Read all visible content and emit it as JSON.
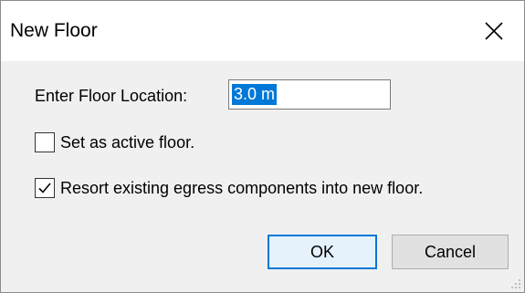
{
  "window": {
    "title": "New Floor",
    "close_icon": "close-icon"
  },
  "form": {
    "floor_location_label": "Enter Floor Location:",
    "floor_location_value": "3.0 m",
    "active_floor": {
      "label": "Set as active floor.",
      "checked": false
    },
    "resort_egress": {
      "label": "Resort existing egress components into new floor.",
      "checked": true
    }
  },
  "buttons": {
    "ok_label": "OK",
    "cancel_label": "Cancel"
  },
  "colors": {
    "accent": "#0078d7",
    "dialog_bg": "#f0f0f0",
    "titlebar_bg": "#ffffff"
  }
}
